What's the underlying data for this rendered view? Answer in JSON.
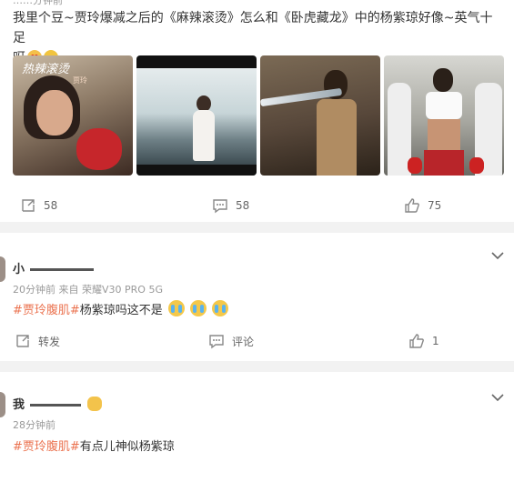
{
  "post": {
    "cut_top_text": "……分钟前",
    "text_parts": {
      "a": "我里个豆~贾玲爆减之后的《麻辣滚烫》怎么和《卧虎藏龙》中的杨紫琼好像~英气十足",
      "b": "呀"
    },
    "emojis": [
      "heart-eyes",
      "laugh"
    ],
    "photos": {
      "p1_title": "热辣滚烫",
      "p1_name": "贾玲"
    },
    "actions": {
      "repost_count": "58",
      "comment_count": "58",
      "like_count": "75"
    }
  },
  "comments": [
    {
      "user": "小",
      "time": "20分钟前",
      "source": "来自 荣耀V30 PRO 5G",
      "tag": "#贾玲腹肌#",
      "text": "杨紫琼吗这不是",
      "emojis": [
        "crying",
        "crying",
        "crying"
      ],
      "actions": {
        "repost": "转发",
        "comment": "评论",
        "like_count": "1"
      }
    },
    {
      "user": "我",
      "time": "28分钟前",
      "tag": "#贾玲腹肌#",
      "text": "有点儿神似杨紫琼",
      "emojis": [
        "blush"
      ]
    }
  ],
  "colors": {
    "tag": "#eb7350",
    "meta": "#999999",
    "text": "#333333",
    "separator": "#f2f2f2"
  }
}
